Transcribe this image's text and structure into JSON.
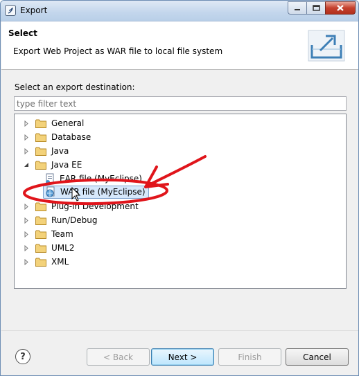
{
  "window": {
    "title": "Export",
    "controls": {
      "minimize": "minimize",
      "maximize": "maximize",
      "close": "close"
    }
  },
  "header": {
    "title": "Select",
    "description": "Export Web Project as WAR file to local file system",
    "icon": "export-wizard-icon"
  },
  "body": {
    "destination_label": "Select an export destination:",
    "filter": {
      "placeholder": "type filter text",
      "value": ""
    }
  },
  "tree": {
    "items": [
      {
        "label": "General",
        "expanded": false
      },
      {
        "label": "Database",
        "expanded": false
      },
      {
        "label": "Java",
        "expanded": false
      },
      {
        "label": "Java EE",
        "expanded": true,
        "children": [
          {
            "label": "EAR file (MyEclipse)",
            "selected": false
          },
          {
            "label": "WAR file (MyEclipse)",
            "selected": true
          }
        ]
      },
      {
        "label": "Plug-in Development",
        "expanded": false
      },
      {
        "label": "Run/Debug",
        "expanded": false
      },
      {
        "label": "Team",
        "expanded": false
      },
      {
        "label": "UML2",
        "expanded": false
      },
      {
        "label": "XML",
        "expanded": false
      }
    ]
  },
  "buttons": {
    "help": "?",
    "back": "< Back",
    "next": "Next >",
    "finish": "Finish",
    "cancel": "Cancel"
  },
  "colors": {
    "annotation": "#e0151b",
    "selection": "#d6e8fb",
    "folder": "#e8c15a"
  }
}
